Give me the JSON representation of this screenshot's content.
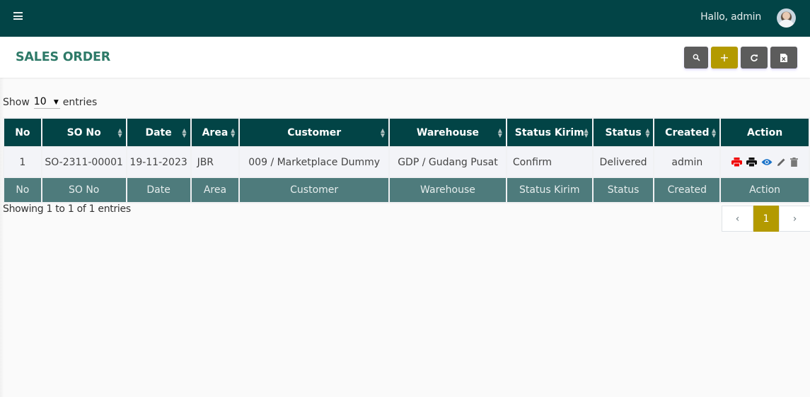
{
  "topbar": {
    "menu_icon": "hamburger-icon",
    "greeting": "Hallo, admin",
    "avatar_icon": "user-avatar"
  },
  "header": {
    "title": "SALES ORDER",
    "buttons": [
      {
        "name": "search",
        "icon": "search-icon",
        "glyph": "🔍"
      },
      {
        "name": "add",
        "icon": "plus-icon",
        "glyph": "+"
      },
      {
        "name": "refresh",
        "icon": "refresh-icon",
        "glyph": "⟳"
      },
      {
        "name": "export",
        "icon": "excel-file-icon",
        "glyph": "X"
      }
    ]
  },
  "length_menu": {
    "prefix": "Show",
    "value": "10",
    "suffix": "entries"
  },
  "table": {
    "columns": [
      "No",
      "SO No",
      "Date",
      "Area",
      "Customer",
      "Warehouse",
      "Status Kirim",
      "Status",
      "Created",
      "Action"
    ],
    "rows": [
      {
        "no": "1",
        "so_no": "SO-2311-00001",
        "date": "19-11-2023",
        "area": "JBR",
        "customer": "009 / Marketplace Dummy",
        "warehouse": "GDP / Gudang Pusat",
        "status_kirim": "Confirm",
        "status": "Delivered",
        "created": "admin",
        "actions": [
          {
            "name": "print-red",
            "icon": "print-icon",
            "color": "#f00000"
          },
          {
            "name": "print-black",
            "icon": "print-icon",
            "color": "#111111"
          },
          {
            "name": "view",
            "icon": "eye-icon",
            "color": "#1a73c9"
          },
          {
            "name": "edit",
            "icon": "pencil-icon",
            "color": "#666666"
          },
          {
            "name": "delete",
            "icon": "trash-icon",
            "color": "#777777"
          }
        ]
      }
    ]
  },
  "info": "Showing 1 to 1 of 1 entries",
  "pagination": {
    "prev": "‹",
    "current": "1",
    "next": "›"
  },
  "colors": {
    "primary": "#024446",
    "accent": "#b39a00",
    "title": "#2e7a68",
    "footer_header": "#4e7b7c"
  }
}
